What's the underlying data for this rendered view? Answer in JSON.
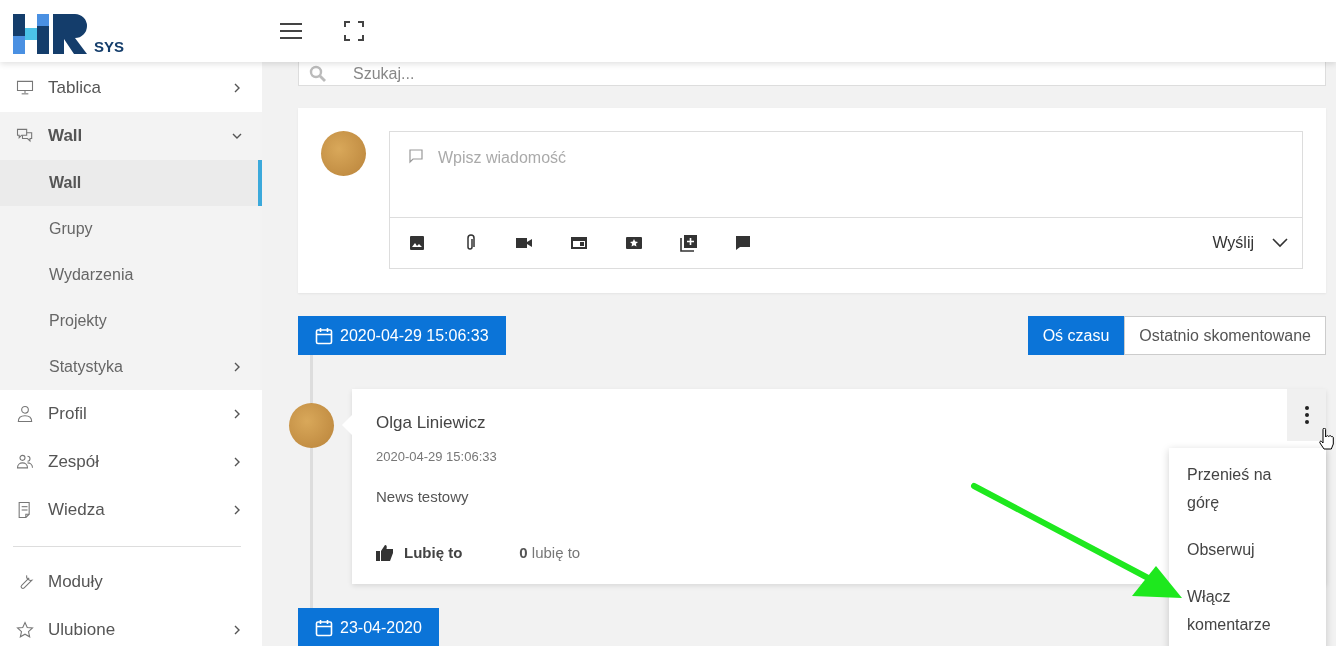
{
  "header": {
    "logo_text": "SYS"
  },
  "sidebar": {
    "sections": [
      [
        {
          "label": "Tablica",
          "has_submenu": true,
          "expanded": false
        },
        {
          "label": "Wall",
          "has_submenu": true,
          "expanded": true,
          "children": [
            {
              "label": "Wall",
              "selected": true,
              "has_submenu": false
            },
            {
              "label": "Grupy",
              "selected": false,
              "has_submenu": false
            },
            {
              "label": "Wydarzenia",
              "selected": false,
              "has_submenu": false
            },
            {
              "label": "Projekty",
              "selected": false,
              "has_submenu": false
            },
            {
              "label": "Statystyka",
              "selected": false,
              "has_submenu": true
            }
          ]
        },
        {
          "label": "Profil",
          "has_submenu": true,
          "expanded": false
        },
        {
          "label": "Zespół",
          "has_submenu": true,
          "expanded": false
        },
        {
          "label": "Wiedza",
          "has_submenu": true,
          "expanded": false
        }
      ],
      [
        {
          "label": "Moduły",
          "has_submenu": false,
          "expanded": false
        },
        {
          "label": "Ulubione",
          "has_submenu": true,
          "expanded": false
        }
      ]
    ]
  },
  "search": {
    "placeholder": "Szukaj..."
  },
  "composer": {
    "placeholder": "Wpisz wiadomość",
    "send_label": "Wyślij"
  },
  "sort_toggle": [
    {
      "label": "Oś czasu",
      "selected": true
    },
    {
      "label": "Ostatnio skomentowane",
      "selected": false
    }
  ],
  "timeline": [
    {
      "date": "2020-04-29 15:06:33",
      "posts": [
        {
          "author": "Olga Liniewicz",
          "time": "2020-04-29 15:06:33",
          "text": "News testowy",
          "like_label": "Lubię to",
          "likes": "**0** lubię to"
        }
      ]
    },
    {
      "date": "23-04-2020"
    }
  ],
  "post_menu": {
    "items": [
      "Przenieś na górę",
      "Obserwuj",
      "Włącz komentarze"
    ]
  }
}
